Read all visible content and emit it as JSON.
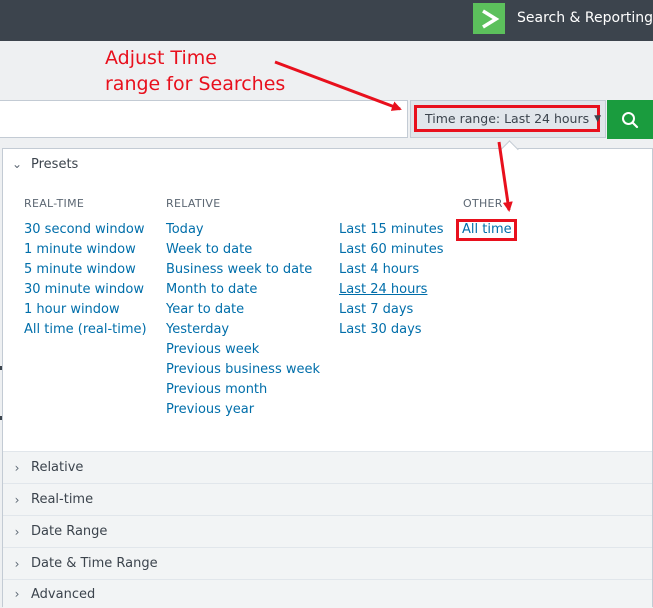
{
  "app": {
    "title": "Search & Reporting",
    "logo_icon": "chevron-right-logo"
  },
  "annotation": {
    "text": "Adjust Time\nrange for Searches",
    "color": "#e8101d"
  },
  "search": {
    "value": "",
    "time_range_label": "Time range: Last 24 hours",
    "button_icon": "search-icon",
    "button_color": "#1a9c3e"
  },
  "presets": {
    "title": "Presets",
    "columns": [
      {
        "heading": "REAL-TIME",
        "items": [
          "30 second window",
          "1 minute window",
          "5 minute window",
          "30 minute window",
          "1 hour window",
          "All time (real-time)"
        ]
      },
      {
        "heading": "RELATIVE",
        "items": [
          "Today",
          "Week to date",
          "Business week to date",
          "Month to date",
          "Year to date",
          "Yesterday",
          "Previous week",
          "Previous business week",
          "Previous month",
          "Previous year"
        ]
      },
      {
        "heading": "",
        "items": [
          "Last 15 minutes",
          "Last 60 minutes",
          "Last 4 hours",
          "Last 24 hours",
          "Last 7 days",
          "Last 30 days"
        ]
      },
      {
        "heading": "OTHER",
        "items": [
          "All time"
        ]
      }
    ],
    "selected": "Last 24 hours"
  },
  "sections": [
    "Relative",
    "Real-time",
    "Date Range",
    "Date & Time Range",
    "Advanced"
  ],
  "colors": {
    "topbar": "#3c444d",
    "link": "#006eaa",
    "accent_green": "#5cc05c"
  }
}
